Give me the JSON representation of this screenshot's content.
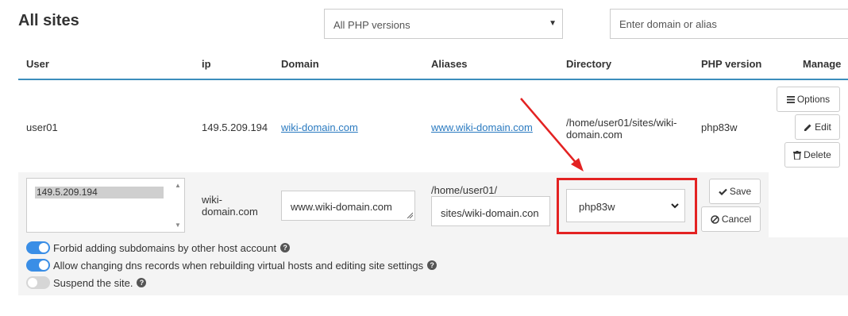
{
  "page": {
    "title": "All sites"
  },
  "filters": {
    "php_select_value": "All PHP versions",
    "search_placeholder": "Enter domain or alias"
  },
  "table": {
    "headers": [
      "User",
      "ip",
      "Domain",
      "Aliases",
      "Directory",
      "PHP version",
      "Manage"
    ],
    "row": {
      "user": "user01",
      "ip": "149.5.209.194",
      "domain": "wiki-domain.com",
      "alias": "www.wiki-domain.com",
      "directory_line1": "/home/user01/sites/wiki-",
      "directory_line2": "domain.com",
      "php": "php83w"
    },
    "manage_buttons": {
      "options": "Options",
      "edit": "Edit",
      "delete": "Delete"
    }
  },
  "edit_form": {
    "ip_option": "149.5.209.194",
    "domain_line1": "wiki-",
    "domain_line2": "domain.com",
    "alias_value": "www.wiki-domain.com",
    "directory_prefix": "/home/user01/",
    "directory_value": "sites/wiki-domain.con",
    "php_value": "php83w",
    "save_label": "Save",
    "cancel_label": "Cancel",
    "toggles": [
      {
        "label": "Forbid adding subdomains by other host account",
        "on": true
      },
      {
        "label": "Allow changing dns records when rebuilding virtual hosts and editing site settings",
        "on": true
      },
      {
        "label": "Suspend the site.",
        "on": false
      }
    ]
  },
  "colors": {
    "accent": "#3c8dbc",
    "link": "#2a7ac0",
    "highlight": "#e32222",
    "toggle_on": "#3a8ee6"
  }
}
